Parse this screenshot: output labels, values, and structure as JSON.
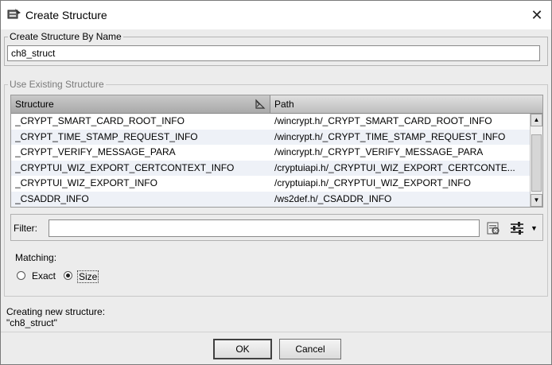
{
  "window": {
    "title": "Create Structure",
    "close_glyph": "✕"
  },
  "name_group": {
    "legend": "Create Structure By Name",
    "input_value": "ch8_struct"
  },
  "existing_group": {
    "legend": "Use Existing Structure",
    "columns": [
      "Structure",
      "Path"
    ],
    "rows": [
      {
        "structure": "_CRYPT_SMART_CARD_ROOT_INFO",
        "path": "/wincrypt.h/_CRYPT_SMART_CARD_ROOT_INFO"
      },
      {
        "structure": "_CRYPT_TIME_STAMP_REQUEST_INFO",
        "path": "/wincrypt.h/_CRYPT_TIME_STAMP_REQUEST_INFO"
      },
      {
        "structure": "_CRYPT_VERIFY_MESSAGE_PARA",
        "path": "/wincrypt.h/_CRYPT_VERIFY_MESSAGE_PARA"
      },
      {
        "structure": "_CRYPTUI_WIZ_EXPORT_CERTCONTEXT_INFO",
        "path": "/cryptuiapi.h/_CRYPTUI_WIZ_EXPORT_CERTCONTE..."
      },
      {
        "structure": "_CRYPTUI_WIZ_EXPORT_INFO",
        "path": "/cryptuiapi.h/_CRYPTUI_WIZ_EXPORT_INFO"
      },
      {
        "structure": "_CSADDR_INFO",
        "path": "/ws2def.h/_CSADDR_INFO"
      }
    ],
    "filter_label": "Filter:",
    "filter_value": "",
    "matching_label": "Matching:",
    "matching_options": [
      "Exact",
      "Size"
    ],
    "matching_selected": "Size"
  },
  "status": {
    "line1": "Creating new structure:",
    "line2": "\"ch8_struct\""
  },
  "buttons": {
    "ok": "OK",
    "cancel": "Cancel"
  },
  "icons": {
    "title": "structure-icon",
    "sort": "sort-icon",
    "filter_clear": "clear-filter-icon",
    "filter_options": "filter-options-icon",
    "filter_dropdown": "dropdown-arrow-icon"
  }
}
